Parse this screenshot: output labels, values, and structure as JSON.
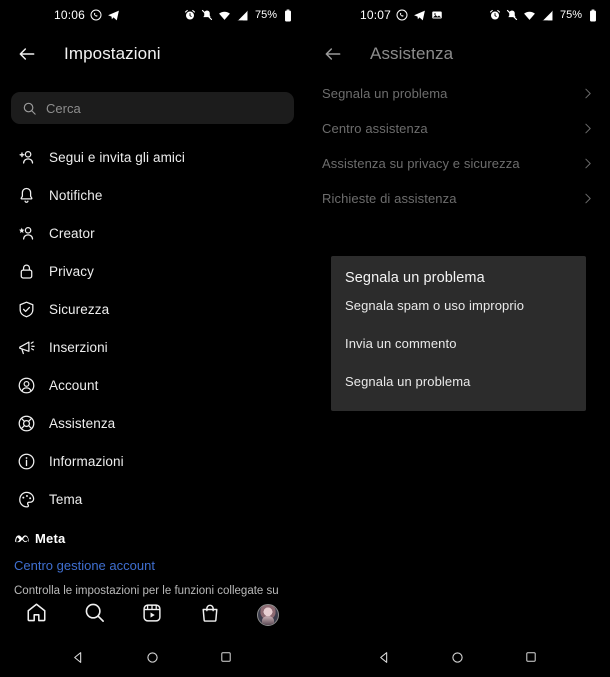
{
  "left_panel": {
    "statusbar": {
      "time": "10:06",
      "left_icons": [
        "whatsapp-icon",
        "telegram-icon"
      ],
      "right_icons": [
        "alarm-icon",
        "mute-icon",
        "wifi-icon",
        "signal-icon"
      ],
      "battery_percent": "75%",
      "battery_icon": "battery-icon"
    },
    "appbar": {
      "back_icon": "back-arrow-icon",
      "title": "Impostazioni"
    },
    "search": {
      "icon": "search-icon",
      "placeholder": "Cerca",
      "value": ""
    },
    "items": [
      {
        "icon": "add-person-icon",
        "label": "Segui e invita gli amici"
      },
      {
        "icon": "bell-icon",
        "label": "Notifiche"
      },
      {
        "icon": "star-person-icon",
        "label": "Creator"
      },
      {
        "icon": "lock-icon",
        "label": "Privacy"
      },
      {
        "icon": "shield-check-icon",
        "label": "Sicurezza"
      },
      {
        "icon": "megaphone-icon",
        "label": "Inserzioni"
      },
      {
        "icon": "account-circle-icon",
        "label": "Account"
      },
      {
        "icon": "lifebuoy-icon",
        "label": "Assistenza"
      },
      {
        "icon": "info-icon",
        "label": "Informazioni"
      },
      {
        "icon": "palette-icon",
        "label": "Tema"
      }
    ],
    "footer": {
      "brand_icon": "meta-logo-icon",
      "brand": "Meta",
      "link": "Centro gestione account",
      "description": "Controlla le impostazioni per le funzioni collegate su"
    },
    "tabbar": [
      {
        "icon": "home-icon",
        "name": "home"
      },
      {
        "icon": "search-icon",
        "name": "search"
      },
      {
        "icon": "reels-icon",
        "name": "reels"
      },
      {
        "icon": "shop-icon",
        "name": "shop"
      },
      {
        "icon": "avatar",
        "name": "profile"
      }
    ],
    "androidnav": [
      {
        "icon": "back-triangle-icon",
        "name": "back"
      },
      {
        "icon": "home-circle-icon",
        "name": "home"
      },
      {
        "icon": "recents-square-icon",
        "name": "recents"
      }
    ]
  },
  "right_panel": {
    "statusbar": {
      "time": "10:07",
      "left_icons": [
        "whatsapp-icon",
        "telegram-icon",
        "photo-icon"
      ],
      "right_icons": [
        "alarm-icon",
        "mute-icon",
        "wifi-icon",
        "signal-icon"
      ],
      "battery_percent": "75%",
      "battery_icon": "battery-icon"
    },
    "appbar": {
      "back_icon": "back-arrow-icon",
      "title": "Assistenza"
    },
    "items": [
      {
        "label": "Segnala un problema",
        "chevron": "chevron-right-icon"
      },
      {
        "label": "Centro assistenza",
        "chevron": "chevron-right-icon"
      },
      {
        "label": "Assistenza su privacy e sicurezza",
        "chevron": "chevron-right-icon"
      },
      {
        "label": "Richieste di assistenza",
        "chevron": "chevron-right-icon"
      }
    ],
    "dialog": {
      "title": "Segnala un problema",
      "options": [
        "Segnala spam o uso improprio",
        "Invia un commento",
        "Segnala un problema"
      ]
    },
    "androidnav": [
      {
        "icon": "back-triangle-icon",
        "name": "back"
      },
      {
        "icon": "home-circle-icon",
        "name": "home"
      },
      {
        "icon": "recents-square-icon",
        "name": "recents"
      }
    ]
  },
  "colors": {
    "background": "#000000",
    "dialog_bg": "#2c2c2c",
    "link_blue": "#3f6fd0",
    "dim_text": "#6d6d6d",
    "primary_text": "#eeeeee"
  }
}
